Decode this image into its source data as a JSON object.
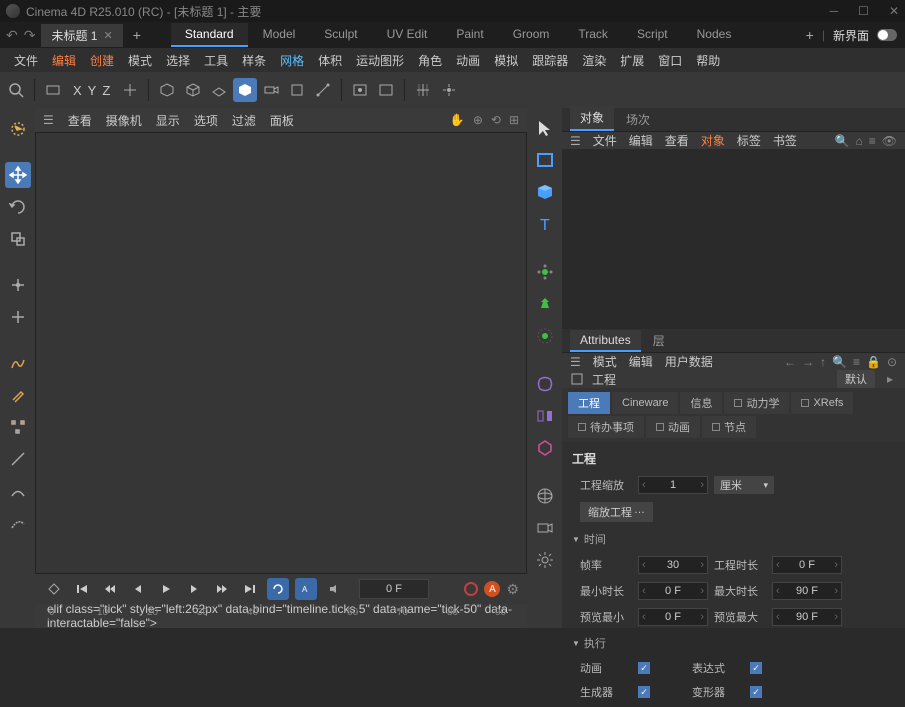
{
  "title": "Cinema 4D R25.010 (RC) - [未标题 1] - 主要",
  "docTab": "未标题 1",
  "layouts": [
    "Standard",
    "Model",
    "Sculpt",
    "UV Edit",
    "Paint",
    "Groom",
    "Track",
    "Script",
    "Nodes"
  ],
  "newUi": "新界面",
  "menu": {
    "file": "文件",
    "edit": "编辑",
    "create": "创建",
    "mode": "模式",
    "select": "选择",
    "tools": "工具",
    "spline": "样条",
    "mesh": "网格",
    "volume": "体积",
    "mograph": "运动图形",
    "char": "角色",
    "anim": "动画",
    "sim": "模拟",
    "tracker": "跟踪器",
    "render": "渲染",
    "ext": "扩展",
    "window": "窗口",
    "help": "帮助"
  },
  "xyz": [
    "X",
    "Y",
    "Z"
  ],
  "vpMenu": {
    "view": "查看",
    "camera": "摄像机",
    "display": "显示",
    "options": "选项",
    "filter": "过滤",
    "panel": "面板"
  },
  "transport": {
    "frame": "0 F"
  },
  "timeline": {
    "ticks": [
      "0",
      "10",
      "20",
      "30",
      "40",
      "50",
      "60",
      "70",
      "80",
      "90"
    ]
  },
  "objPanel": {
    "tabs": {
      "objects": "对象",
      "takes": "场次"
    },
    "menu": {
      "file": "文件",
      "edit": "编辑",
      "view": "查看",
      "objects": "对象",
      "tags": "标签",
      "bookmarks": "书签"
    }
  },
  "attrPanel": {
    "tabs": {
      "attributes": "Attributes",
      "layers": "层"
    },
    "menu": {
      "mode": "模式",
      "edit": "编辑",
      "userdata": "用户数据"
    },
    "headLabel": "工程",
    "defaultBtn": "默认",
    "innerTabs": {
      "project": "工程",
      "cineware": "Cineware",
      "info": "信息",
      "dynamics": "动力学",
      "xrefs": "XRefs",
      "todo": "待办事项",
      "anim": "动画",
      "nodes": "节点"
    },
    "sections": {
      "project": "工程",
      "projectScale": "工程缩放",
      "scaleValue": "1",
      "unit": "厘米",
      "scaleProject": "缩放工程",
      "time": "时间",
      "fps": "帧率",
      "fpsVal": "30",
      "projLen": "工程时长",
      "projLenVal": "0 F",
      "minLen": "最小时长",
      "minLenVal": "0 F",
      "maxLen": "最大时长",
      "maxLenVal": "90 F",
      "prevMin": "预览最小",
      "prevMinVal": "0 F",
      "prevMax": "预览最大",
      "prevMaxVal": "90 F",
      "exec": "执行",
      "animation": "动画",
      "expressions": "表达式",
      "generators": "生成器",
      "deformers": "变形器"
    }
  }
}
